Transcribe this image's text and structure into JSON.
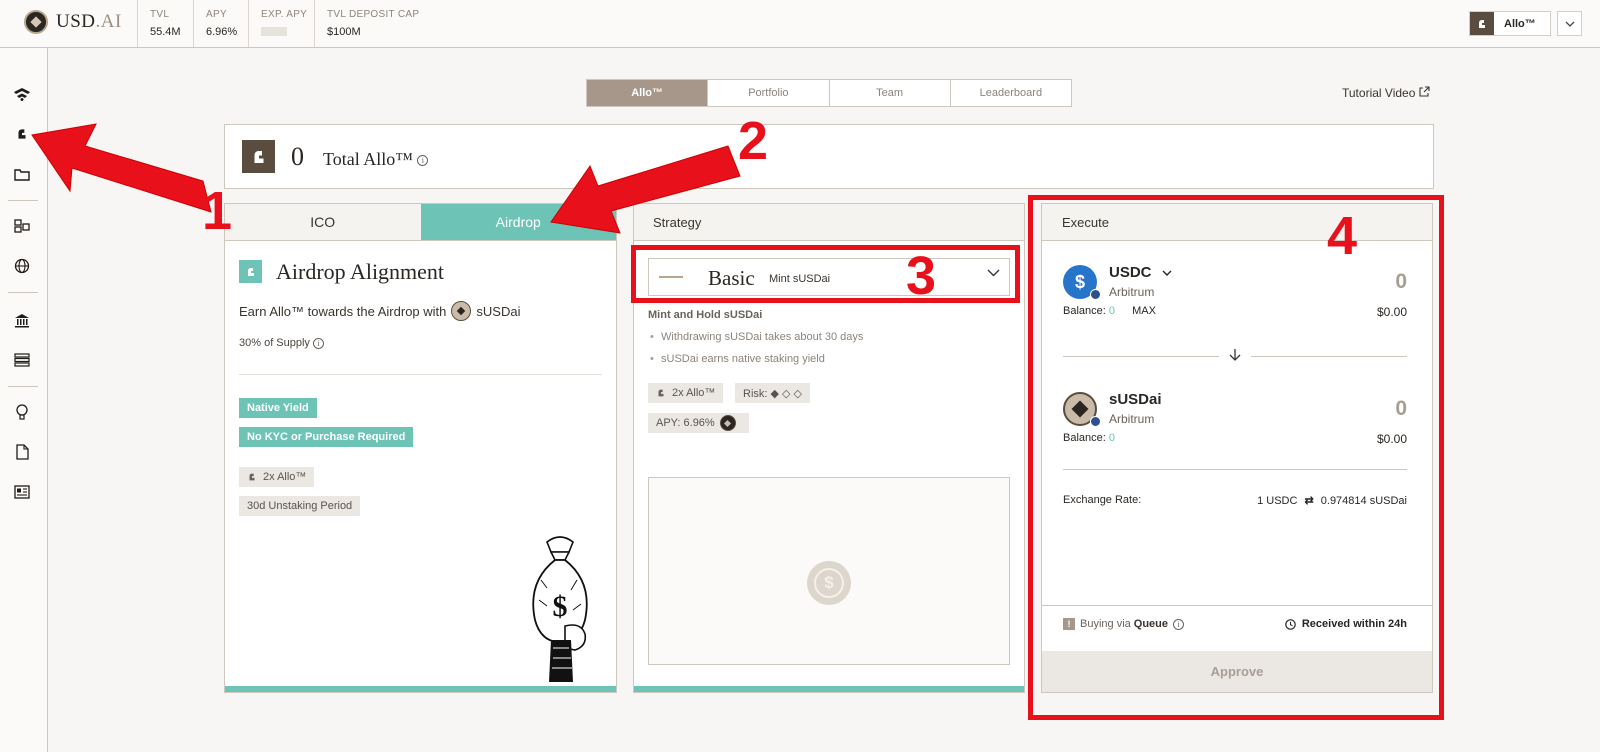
{
  "header": {
    "logo_text": "USD",
    "logo_suffix": ".AI",
    "stats": [
      {
        "key": "TVL",
        "value": "55.4M"
      },
      {
        "key": "APY",
        "value": "6.96%"
      },
      {
        "key": "EXP. APY",
        "value": ""
      },
      {
        "key": "TVL DEPOSIT CAP",
        "value": "$100M"
      }
    ],
    "account_label": "Allo™"
  },
  "nav": {
    "tabs": [
      "Allo™",
      "Portfolio",
      "Team",
      "Leaderboard"
    ],
    "active": "Allo™",
    "tutorial": "Tutorial Video"
  },
  "total": {
    "value": "0",
    "label": "Total Allo™"
  },
  "program": {
    "tabs": [
      "ICO",
      "Airdrop"
    ],
    "active": "Airdrop",
    "title": "Airdrop Alignment",
    "subtitle_prefix": "Earn Allo™ towards the Airdrop with",
    "subtitle_token": "sUSDai",
    "supply": "30% of Supply",
    "chips_highlight": [
      "Native Yield",
      "No KYC or Purchase Required"
    ],
    "chips": [
      "2x Allo™",
      "30d Unstaking Period"
    ]
  },
  "strategy": {
    "header": "Strategy",
    "selected_name": "Basic",
    "selected_sub": "Mint sUSDai",
    "description_title": "Mint and Hold sUSDai",
    "bullets": [
      "Withdrawing sUSDai takes about 30 days",
      "sUSDai earns native staking yield"
    ],
    "chip_allo": "2x Allo™",
    "chip_risk": "Risk: ◆ ◇ ◇",
    "chip_apy": "APY: 6.96%"
  },
  "execute": {
    "header": "Execute",
    "from": {
      "token": "USDC",
      "chain": "Arbitrum",
      "amount": "0",
      "balance_label": "Balance:",
      "balance": "0",
      "max": "MAX",
      "usd": "$0.00"
    },
    "to": {
      "token": "sUSDai",
      "chain": "Arbitrum",
      "amount": "0",
      "balance_label": "Balance:",
      "balance": "0",
      "usd": "$0.00"
    },
    "exchange_label": "Exchange Rate:",
    "exchange_from": "1 USDC",
    "exchange_to": "0.974814 sUSDai",
    "buying_prefix": "Buying via",
    "buying_method": "Queue",
    "received": "Received within 24h",
    "approve": "Approve"
  },
  "annotations": [
    "1",
    "2",
    "3",
    "4"
  ],
  "colors": {
    "accent": "#6cc3b6",
    "brand_dark": "#5a4d40",
    "tab_active": "#a7978a",
    "annotation": "#e8101a"
  }
}
